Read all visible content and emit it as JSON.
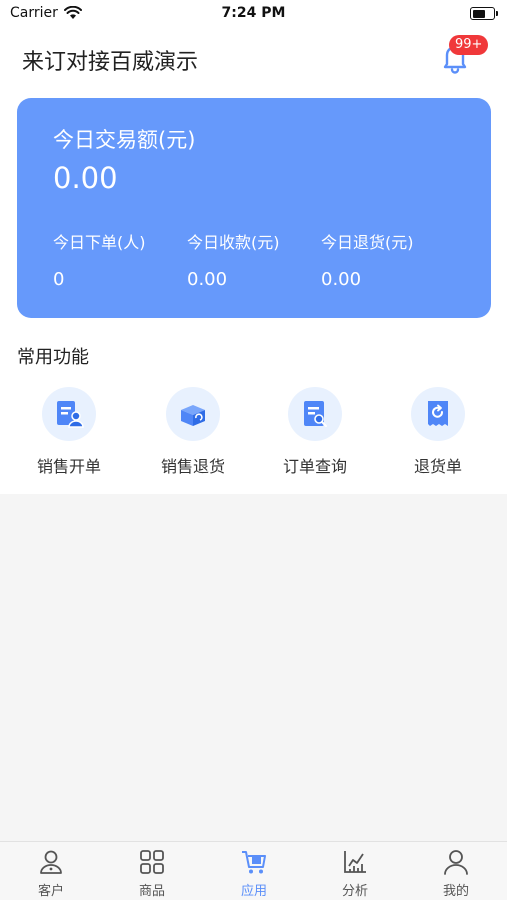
{
  "status_bar": {
    "carrier": "Carrier",
    "time": "7:24 PM"
  },
  "header": {
    "title": "来订对接百威演示",
    "notification_badge": "99+"
  },
  "summary": {
    "title": "今日交易额(元)",
    "amount": "0.00",
    "stats": [
      {
        "label": "今日下单(人)",
        "value": "0"
      },
      {
        "label": "今日收款(元)",
        "value": "0.00"
      },
      {
        "label": "今日退货(元)",
        "value": "0.00"
      }
    ]
  },
  "functions": {
    "title": "常用功能",
    "items": [
      {
        "label": "销售开单",
        "icon": "sales-order-icon"
      },
      {
        "label": "销售退货",
        "icon": "sales-return-icon"
      },
      {
        "label": "订单查询",
        "icon": "order-query-icon"
      },
      {
        "label": "退货单",
        "icon": "return-receipt-icon"
      }
    ]
  },
  "tabbar": {
    "active": "应用",
    "items": [
      {
        "label": "客户",
        "icon": "customer-icon"
      },
      {
        "label": "商品",
        "icon": "product-grid-icon"
      },
      {
        "label": "应用",
        "icon": "cart-app-icon"
      },
      {
        "label": "分析",
        "icon": "chart-icon"
      },
      {
        "label": "我的",
        "icon": "profile-icon"
      }
    ]
  },
  "colors": {
    "accent": "#5b8ff9",
    "card": "#6699fb",
    "badge": "#f0383a",
    "icon_bg": "#e8f1fe"
  }
}
